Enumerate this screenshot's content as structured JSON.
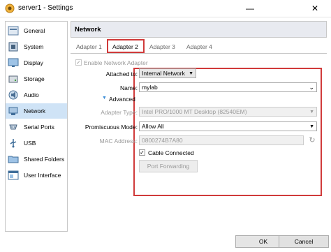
{
  "window": {
    "title": "server1 - Settings"
  },
  "sidebar": {
    "items": [
      {
        "label": "General",
        "icon": "general-icon"
      },
      {
        "label": "System",
        "icon": "system-icon"
      },
      {
        "label": "Display",
        "icon": "display-icon"
      },
      {
        "label": "Storage",
        "icon": "storage-icon"
      },
      {
        "label": "Audio",
        "icon": "audio-icon"
      },
      {
        "label": "Network",
        "icon": "network-icon",
        "active": true
      },
      {
        "label": "Serial Ports",
        "icon": "serial-ports-icon"
      },
      {
        "label": "USB",
        "icon": "usb-icon"
      },
      {
        "label": "Shared Folders",
        "icon": "shared-folders-icon"
      },
      {
        "label": "User Interface",
        "icon": "user-interface-icon"
      }
    ]
  },
  "header": {
    "title": "Network"
  },
  "tabs": [
    {
      "label": "Adapter 1"
    },
    {
      "label": "Adapter 2",
      "active": true
    },
    {
      "label": "Adapter 3"
    },
    {
      "label": "Adapter 4"
    }
  ],
  "form": {
    "enable_label": "Enable Network Adapter",
    "attached_label": "Attached to:",
    "attached_value": "Internal Network",
    "name_label": "Name:",
    "name_value": "mylab",
    "advanced_label": "Advanced",
    "adapter_type_label": "Adapter Type:",
    "adapter_type_value": "Intel PRO/1000 MT Desktop (82540EM)",
    "promiscuous_label": "Promiscuous Mode:",
    "promiscuous_value": "Allow All",
    "mac_label": "MAC Address:",
    "mac_value": "0800274B7A80",
    "cable_label": "Cable Connected",
    "port_forwarding_label": "Port Forwarding"
  },
  "footer": {
    "ok_label": "OK",
    "cancel_label": "Cancel"
  },
  "colors": {
    "highlight": "#d03a3a",
    "selected": "#cfe3f6"
  }
}
